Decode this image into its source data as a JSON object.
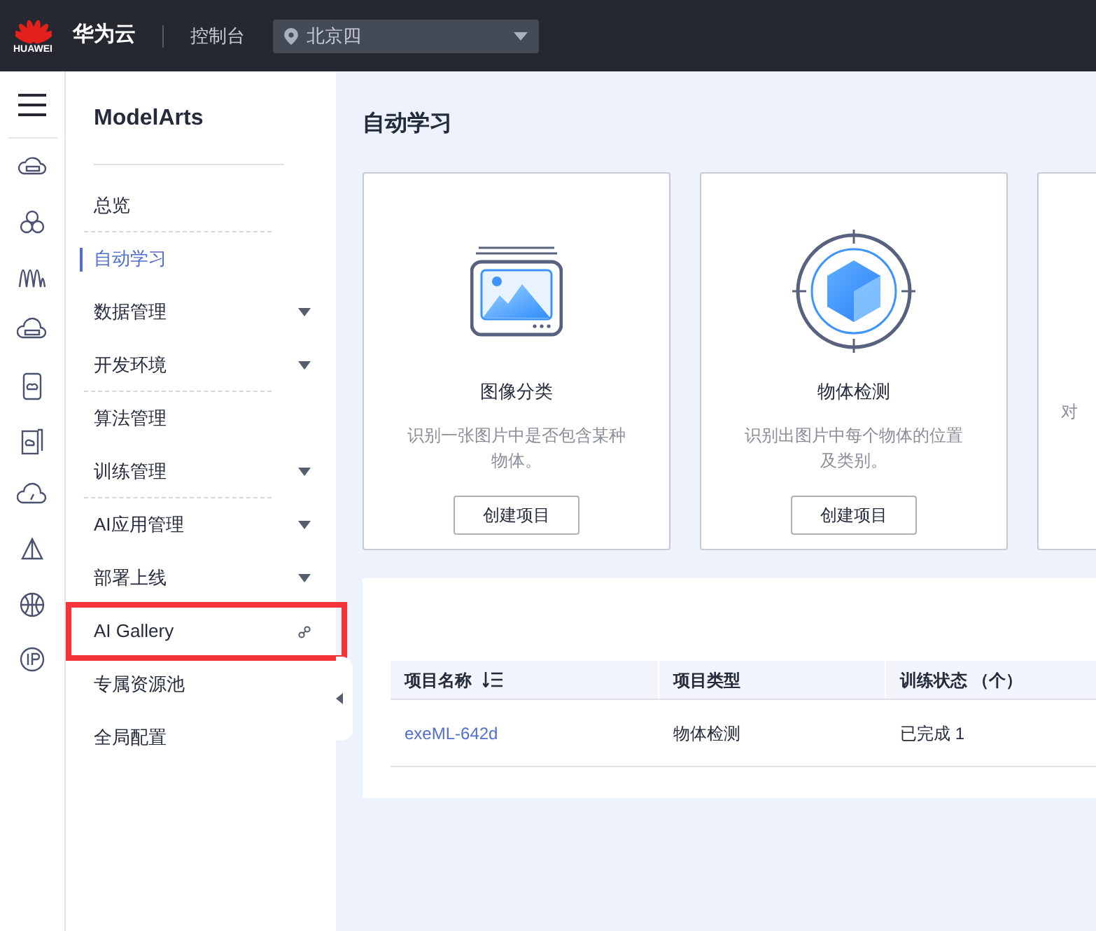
{
  "top_bar": {
    "logo_text": "HUAWEI",
    "brand": "华为云",
    "console": "控制台",
    "region": "北京四"
  },
  "sidebar": {
    "title": "ModelArts",
    "items": [
      {
        "label": "总览",
        "kind": "plain",
        "selected": false,
        "separator": true,
        "highlighted": false
      },
      {
        "label": "自动学习",
        "kind": "plain",
        "selected": true,
        "separator": false,
        "highlighted": false
      },
      {
        "label": "数据管理",
        "kind": "expandable",
        "selected": false,
        "separator": false,
        "highlighted": false
      },
      {
        "label": "开发环境",
        "kind": "expandable",
        "selected": false,
        "separator": true,
        "highlighted": false
      },
      {
        "label": "算法管理",
        "kind": "plain",
        "selected": false,
        "separator": false,
        "highlighted": false
      },
      {
        "label": "训练管理",
        "kind": "expandable",
        "selected": false,
        "separator": true,
        "highlighted": false
      },
      {
        "label": "AI应用管理",
        "kind": "expandable",
        "selected": false,
        "separator": false,
        "highlighted": false
      },
      {
        "label": "部署上线",
        "kind": "expandable",
        "selected": false,
        "separator": false,
        "highlighted": false
      },
      {
        "label": "AI Gallery",
        "kind": "external",
        "selected": false,
        "separator": false,
        "highlighted": true
      },
      {
        "label": "专属资源池",
        "kind": "plain",
        "selected": false,
        "separator": false,
        "highlighted": false
      },
      {
        "label": "全局配置",
        "kind": "plain",
        "selected": false,
        "separator": false,
        "highlighted": false
      }
    ]
  },
  "page_title": "自动学习",
  "cards": [
    {
      "kind": "image",
      "title": "图像分类",
      "description": "识别一张图片中是否包含某种物体。",
      "button": "创建项目"
    },
    {
      "kind": "object",
      "title": "物体检测",
      "description": "识别出图片中每个物体的位置及类别。",
      "button": "创建项目"
    },
    {
      "kind": "cut",
      "description": "对"
    }
  ],
  "table": {
    "columns": [
      {
        "label": "项目名称",
        "sortable": true
      },
      {
        "label": "项目类型",
        "sortable": false
      },
      {
        "label": "训练状态 （个）",
        "sortable": false
      }
    ],
    "rows": [
      {
        "name": "exeML-642d",
        "type": "物体检测",
        "status": "已完成 1"
      }
    ]
  }
}
